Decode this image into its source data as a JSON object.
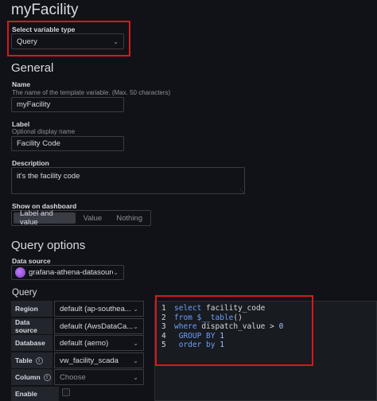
{
  "page": {
    "title": "myFacility"
  },
  "variable_type": {
    "label": "Select variable type",
    "value": "Query"
  },
  "general": {
    "heading": "General",
    "name": {
      "label": "Name",
      "description": "The name of the template variable. (Max. 50 characters)",
      "value": "myFacility"
    },
    "display_label": {
      "label": "Label",
      "description": "Optional display name",
      "value": "Facility Code"
    },
    "description": {
      "label": "Description",
      "value": "it's the facility code"
    },
    "show_on_dashboard": {
      "label": "Show on dashboard",
      "options": [
        "Label and value",
        "Value",
        "Nothing"
      ],
      "selected": "Label and value"
    }
  },
  "query_options": {
    "heading": "Query options",
    "data_source": {
      "label": "Data source",
      "value": "grafana-athena-datasource"
    },
    "query_label": "Query",
    "rows": [
      {
        "label": "Region",
        "value": "default (ap-southea..."
      },
      {
        "label": "Data source",
        "value": "default (AwsDataCa..."
      },
      {
        "label": "Database",
        "value": "default (aemo)"
      },
      {
        "label": "Table",
        "value": "vw_facility_scada"
      },
      {
        "label": "Column",
        "value": "Choose"
      },
      {
        "label": "Enable",
        "value": ""
      }
    ]
  },
  "code": {
    "lines": [
      {
        "n": "1",
        "parts": [
          {
            "t": "select",
            "c": "kw"
          },
          {
            "t": " facility_code",
            "c": "id"
          }
        ]
      },
      {
        "n": "2",
        "parts": [
          {
            "t": "from",
            "c": "kw"
          },
          {
            "t": " $__table",
            "c": "kw"
          },
          {
            "t": "()",
            "c": "id"
          }
        ]
      },
      {
        "n": "3",
        "parts": [
          {
            "t": "where",
            "c": "kw"
          },
          {
            "t": " dispatch_value > ",
            "c": "id"
          },
          {
            "t": "0",
            "c": "num"
          }
        ]
      },
      {
        "n": "4",
        "parts": [
          {
            "t": " GROUP BY",
            "c": "kw"
          },
          {
            "t": " ",
            "c": "id"
          },
          {
            "t": "1",
            "c": "num"
          }
        ]
      },
      {
        "n": "5",
        "parts": [
          {
            "t": " order by",
            "c": "kw"
          },
          {
            "t": " ",
            "c": "id"
          },
          {
            "t": "1",
            "c": "num"
          }
        ]
      }
    ]
  },
  "colors": {
    "highlight": "#d7191b",
    "keyword": "#6e9fff",
    "background": "#111217"
  }
}
